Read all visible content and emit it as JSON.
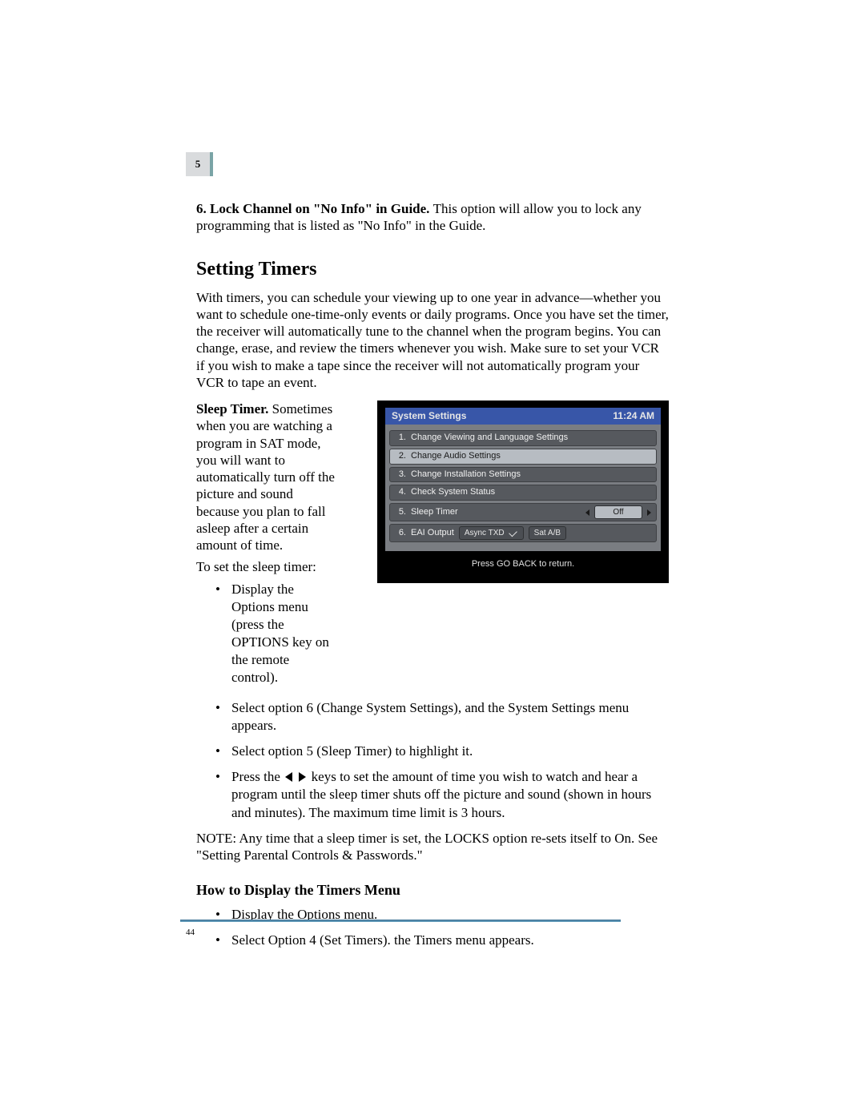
{
  "chapter_tab": "5",
  "page_number": "44",
  "lock_channel": {
    "lead": "6. Lock Channel on \"No Info\" in Guide. ",
    "text": "This option will allow you to lock any programming that is listed as \"No Info\" in the Guide."
  },
  "heading_timers": "Setting Timers",
  "timers_intro": "With timers, you can schedule your viewing up to one year in advance—whether you want to schedule one-time-only events or daily programs. Once you have set the timer, the receiver will automatically tune to the channel when the program begins. You can change, erase, and review the timers whenever you wish. Make sure to set your VCR if you wish to make a tape since the receiver will not automatically program your VCR to tape an event.",
  "sleep_timer": {
    "lead": "Sleep Timer. ",
    "p1": "Sometimes when you are watching a program in SAT mode, you will want to automatically turn off the picture and sound because you plan to fall asleep after a certain amount of time.",
    "p2": "To set the sleep timer:",
    "b1": "Display the Options menu (press the OPTIONS key on the remote control).",
    "b2": "Select option 6 (Change System Settings), and the System Settings menu appears.",
    "b3": "Select option 5 (Sleep Timer) to highlight it.",
    "b4a": "Press the ",
    "b4b": " keys to set the amount of time you wish to watch and hear a program until the sleep timer shuts off the picture and sound (shown in hours and minutes). The maximum time limit is 3 hours."
  },
  "note": "NOTE: Any time that a sleep timer is set, the LOCKS option re-sets itself to On. See \"Setting Parental Controls & Passwords.\"",
  "heading_display": "How to Display the Timers Menu",
  "display_b1": "Display the Options menu.",
  "display_b2": "Select Option 4 (Set Timers). the Timers menu appears.",
  "osd": {
    "title": "System Settings",
    "time": "11:24 AM",
    "rows": [
      {
        "n": "1.",
        "label": "Change Viewing and Language Settings"
      },
      {
        "n": "2.",
        "label": "Change Audio Settings"
      },
      {
        "n": "3.",
        "label": "Change Installation Settings"
      },
      {
        "n": "4.",
        "label": "Check System Status"
      },
      {
        "n": "5.",
        "label": "Sleep Timer"
      },
      {
        "n": "6.",
        "label": "EAI Output"
      }
    ],
    "off": "Off",
    "async": "Async TXD",
    "satab": "Sat A/B",
    "footer": "Press GO BACK to return."
  }
}
